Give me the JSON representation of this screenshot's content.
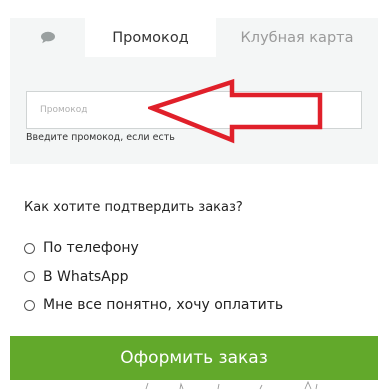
{
  "tabs": {
    "chat_icon": "chat-bubble-icon",
    "promo_label": "Промокод",
    "card_label": "Клубная карта"
  },
  "promo": {
    "placeholder": "Промокод",
    "value": "",
    "hint": "Введите промокод, если есть"
  },
  "confirm": {
    "title": "Как хотите подтвердить заказ?",
    "options": [
      {
        "label": "По телефону",
        "selected": false
      },
      {
        "label": "В WhatsApp",
        "selected": false
      },
      {
        "label": "Мне все понятно, хочу оплатить",
        "selected": false
      }
    ]
  },
  "submit": {
    "label": "Оформить заказ"
  },
  "colors": {
    "accent_green": "#62a92b",
    "panel_bg": "#f4f6f6",
    "annotation_red": "#e0202a"
  }
}
